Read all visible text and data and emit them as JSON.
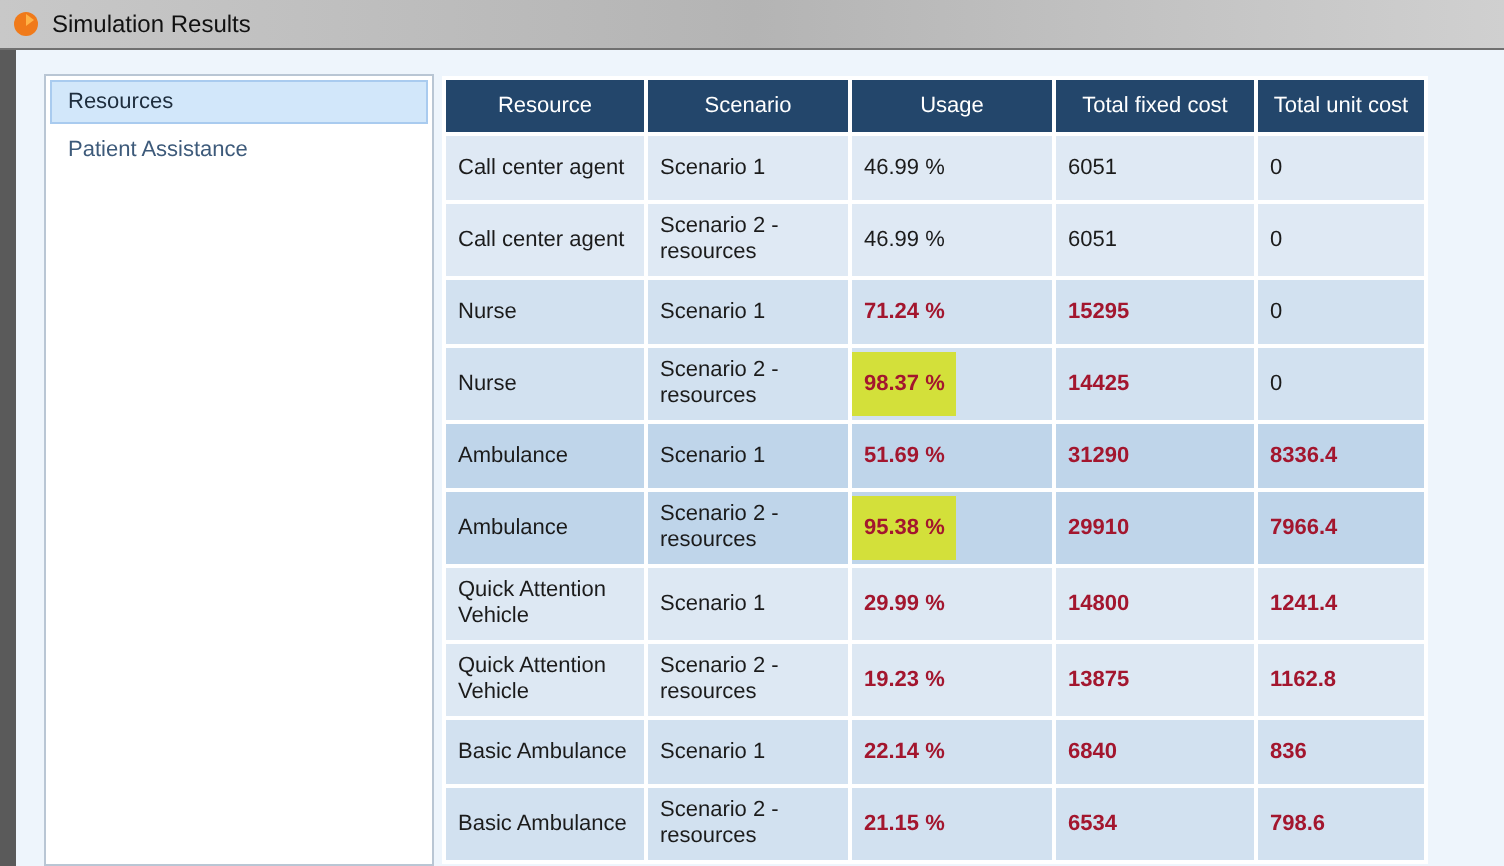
{
  "window": {
    "title": "Simulation Results"
  },
  "sidebar": {
    "items": [
      {
        "label": "Resources",
        "selected": true
      },
      {
        "label": "Patient Assistance",
        "selected": false
      }
    ]
  },
  "table": {
    "columns": [
      "Resource",
      "Scenario",
      "Usage",
      "Total fixed cost",
      "Total unit cost"
    ],
    "rows": [
      {
        "color": "#dfe9f4",
        "resource": "Call center agent",
        "scenario": "Scenario 1",
        "usage": {
          "text": "46.99 %",
          "flagged": false,
          "highlighted": false
        },
        "fixed_cost": {
          "text": "6051",
          "flagged": false
        },
        "unit_cost": {
          "text": "0",
          "flagged": false
        }
      },
      {
        "color": "#dfe9f4",
        "resource": "Call center agent",
        "scenario": "Scenario 2 - resources",
        "usage": {
          "text": "46.99 %",
          "flagged": false,
          "highlighted": false
        },
        "fixed_cost": {
          "text": "6051",
          "flagged": false
        },
        "unit_cost": {
          "text": "0",
          "flagged": false
        }
      },
      {
        "color": "#d2e1f0",
        "resource": "Nurse",
        "scenario": "Scenario 1",
        "usage": {
          "text": "71.24 %",
          "flagged": true,
          "highlighted": false
        },
        "fixed_cost": {
          "text": "15295",
          "flagged": true
        },
        "unit_cost": {
          "text": "0",
          "flagged": false
        }
      },
      {
        "color": "#d2e1f0",
        "resource": "Nurse",
        "scenario": "Scenario 2 - resources",
        "usage": {
          "text": "98.37 %",
          "flagged": true,
          "highlighted": true
        },
        "fixed_cost": {
          "text": "14425",
          "flagged": true
        },
        "unit_cost": {
          "text": "0",
          "flagged": false
        }
      },
      {
        "color": "#bfd5ea",
        "resource": "Ambulance",
        "scenario": "Scenario 1",
        "usage": {
          "text": "51.69 %",
          "flagged": true,
          "highlighted": false
        },
        "fixed_cost": {
          "text": "31290",
          "flagged": true
        },
        "unit_cost": {
          "text": "8336.4",
          "flagged": true
        }
      },
      {
        "color": "#bfd5ea",
        "resource": "Ambulance",
        "scenario": "Scenario 2 - resources",
        "usage": {
          "text": "95.38 %",
          "flagged": true,
          "highlighted": true
        },
        "fixed_cost": {
          "text": "29910",
          "flagged": true
        },
        "unit_cost": {
          "text": "7966.4",
          "flagged": true
        }
      },
      {
        "color": "#dde8f3",
        "resource": "Quick Attention Vehicle",
        "scenario": "Scenario 1",
        "usage": {
          "text": "29.99 %",
          "flagged": true,
          "highlighted": false
        },
        "fixed_cost": {
          "text": "14800",
          "flagged": true
        },
        "unit_cost": {
          "text": "1241.4",
          "flagged": true
        }
      },
      {
        "color": "#dde8f3",
        "resource": "Quick Attention Vehicle",
        "scenario": "Scenario 2 - resources",
        "usage": {
          "text": "19.23 %",
          "flagged": true,
          "highlighted": false
        },
        "fixed_cost": {
          "text": "13875",
          "flagged": true
        },
        "unit_cost": {
          "text": "1162.8",
          "flagged": true
        }
      },
      {
        "color": "#d2e1f0",
        "resource": "Basic Ambulance",
        "scenario": "Scenario 1",
        "usage": {
          "text": "22.14 %",
          "flagged": true,
          "highlighted": false
        },
        "fixed_cost": {
          "text": "6840",
          "flagged": true
        },
        "unit_cost": {
          "text": "836",
          "flagged": true
        }
      },
      {
        "color": "#d2e1f0",
        "resource": "Basic Ambulance",
        "scenario": "Scenario 2 - resources",
        "usage": {
          "text": "21.15 %",
          "flagged": true,
          "highlighted": false
        },
        "fixed_cost": {
          "text": "6534",
          "flagged": true
        },
        "unit_cost": {
          "text": "798.6",
          "flagged": true
        }
      }
    ]
  }
}
